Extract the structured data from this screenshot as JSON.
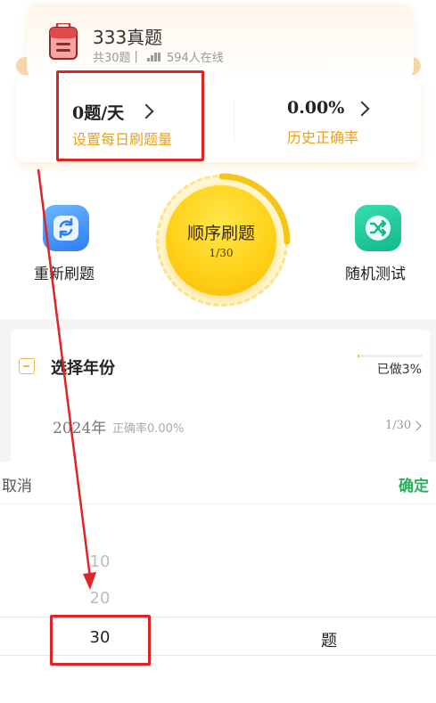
{
  "header": {
    "title": "333真题",
    "question_count": "共30题",
    "online": "594人在线"
  },
  "stats": {
    "daily_value": "0题/天",
    "daily_label": "设置每日刷题量",
    "accuracy_value": "0.00%",
    "accuracy_label": "历史正确率"
  },
  "actions": {
    "redo_label": "重新刷题",
    "sequential_label": "顺序刷题",
    "sequential_progress": "1/30",
    "random_label": "随机测试"
  },
  "year_section": {
    "title": "选择年份",
    "done_text": "已做3%",
    "done_fraction": 0.03,
    "rows": [
      {
        "year": "2024年",
        "rate": "正确率0.00%",
        "count": "1/30"
      }
    ]
  },
  "picker": {
    "cancel": "取消",
    "confirm": "确定",
    "options": [
      "10",
      "20"
    ],
    "selected": "30",
    "unit": "题"
  },
  "colors": {
    "accent_orange": "#e8a21d",
    "confirm_green": "#27b05c",
    "annotation_red": "#e02424",
    "primary_yellow": "#ffd21a"
  }
}
